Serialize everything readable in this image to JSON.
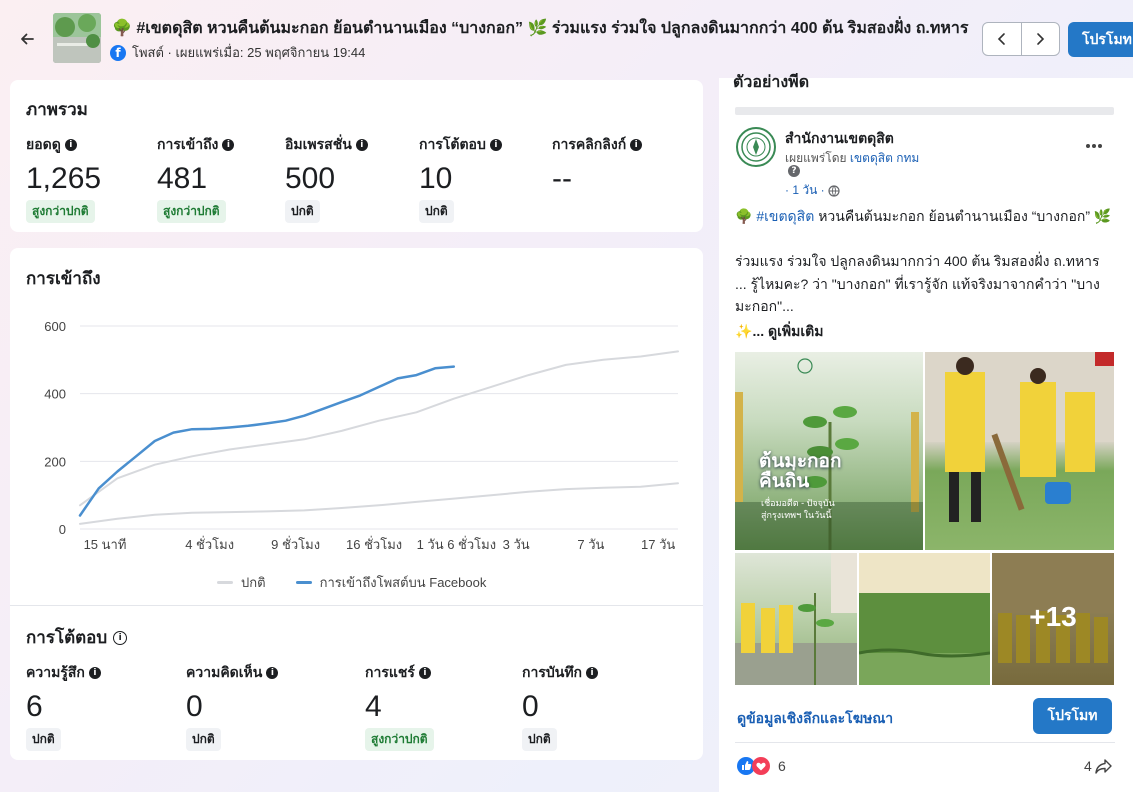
{
  "header": {
    "title": "🌳 #เขตดุสิต หวนคืนต้นมะกอก ย้อนตำนานเมือง “บางกอก” 🌿 ร่วมแรง ร่วมใจ ปลูกลงดินมากกว่า 400 ต้น ริมสองฝั่ง ถ.ทหาร",
    "subtitle": "โพสต์ · เผยแพร่เมื่อ: 25 พฤศจิกายน 19:44",
    "promote_label": "โปรโมท"
  },
  "overview": {
    "title": "ภาพรวม",
    "metrics": [
      {
        "label": "ยอดดู",
        "value": "1,265",
        "badge": "สูงกว่าปกติ"
      },
      {
        "label": "การเข้าถึง",
        "value": "481",
        "badge": "สูงกว่าปกติ"
      },
      {
        "label": "อิมเพรสชั่น",
        "value": "500",
        "badge": "ปกติ"
      },
      {
        "label": "การโต้ตอบ",
        "value": "10",
        "badge": "ปกติ"
      },
      {
        "label": "การคลิกลิงก์",
        "value": "--",
        "badge": ""
      }
    ]
  },
  "reach": {
    "title": "การเข้าถึง",
    "legend_normal": "ปกติ",
    "legend_fb": "การเข้าถึงโพสต์บน Facebook"
  },
  "engagement": {
    "title": "การโต้ตอบ",
    "metrics": [
      {
        "label": "ความรู้สึก",
        "value": "6",
        "badge": "ปกติ"
      },
      {
        "label": "ความคิดเห็น",
        "value": "0",
        "badge": "ปกติ"
      },
      {
        "label": "การแชร์",
        "value": "4",
        "badge": "สูงกว่าปกติ"
      },
      {
        "label": "การบันทึก",
        "value": "0",
        "badge": "ปกติ"
      }
    ]
  },
  "chart_data": {
    "type": "line",
    "title": "",
    "xlabel": "",
    "ylabel": "",
    "ylim": [
      0,
      600
    ],
    "yticks": [
      "0",
      "200",
      "400",
      "600"
    ],
    "xticks": [
      "15 นาที",
      "4 ชั่วโมง",
      "9 ชั่วโมง",
      "16 ชั่วโมง",
      "1 วัน 6 ชั่วโมง",
      "3 วัน",
      "7 วัน",
      "17 วัน"
    ],
    "grid": true,
    "legend": "bottom",
    "x": [
      0,
      0.5,
      1,
      1.5,
      2,
      2.5,
      3,
      3.5,
      4,
      4.5,
      5,
      5.5,
      6,
      6.5,
      7,
      7.5,
      8
    ],
    "series": [
      {
        "name": "ปกติ",
        "color": "#d7d9dd",
        "values": [
          70,
          150,
          190,
          215,
          235,
          250,
          265,
          290,
          320,
          345,
          385,
          420,
          455,
          485,
          500,
          510,
          525
        ]
      },
      {
        "name": "ปกติ",
        "color": "#d7d9dd",
        "values": [
          15,
          30,
          42,
          48,
          50,
          52,
          55,
          62,
          70,
          80,
          90,
          100,
          110,
          118,
          122,
          125,
          135
        ]
      },
      {
        "name": "การเข้าถึงโพสต์บน Facebook",
        "color": "#4a8fcf",
        "x": [
          0,
          0.25,
          0.5,
          0.75,
          1,
          1.25,
          1.5,
          1.75,
          2,
          2.25,
          2.5,
          2.75,
          3,
          3.25,
          3.5,
          3.75,
          4,
          4.25,
          4.5,
          4.75,
          5
        ],
        "values": [
          40,
          120,
          170,
          215,
          260,
          285,
          295,
          296,
          300,
          305,
          312,
          320,
          335,
          355,
          375,
          395,
          420,
          445,
          455,
          475,
          480
        ]
      }
    ]
  },
  "preview": {
    "title": "ตัวอย่างพีด",
    "page_name": "สำนักงานเขตดุสิต",
    "published_by_prefix": "เผยแพร่โดย",
    "published_by": "เขตดุสิต กทม",
    "time": "· 1 วัน ·",
    "line1_tag": "#เขตดุสิต",
    "line1": "หวนคืนต้นมะกอก ย้อนตำนานเมือง “บางกอก”",
    "line2": "ร่วมแรง ร่วมใจ ปลูกลงดินมากกว่า 400 ต้น ริมสองฝั่ง ถ.ทหาร",
    "line3": "... รู้ไหมคะ? ว่า \"บางกอก\" ที่เรารู้จัก แท้จริงมาจากคำว่า \"บาง",
    "line4": "มะกอก\"...",
    "see_more": "... ดูเพิ่มเติม",
    "poster_title": "ต้นมะกอก คืนถิ่น",
    "poster_sub1": "เชื่อมอดีต - ปัจจุบัน",
    "poster_sub2": "สู่กรุงเทพฯ ในวันนี้",
    "more_count": "+13",
    "insights_link": "ดูข้อมูลเชิงลึกและโฆษณา",
    "promote_label": "โปรโมท",
    "reactions_count": "6",
    "shares_count": "4"
  }
}
